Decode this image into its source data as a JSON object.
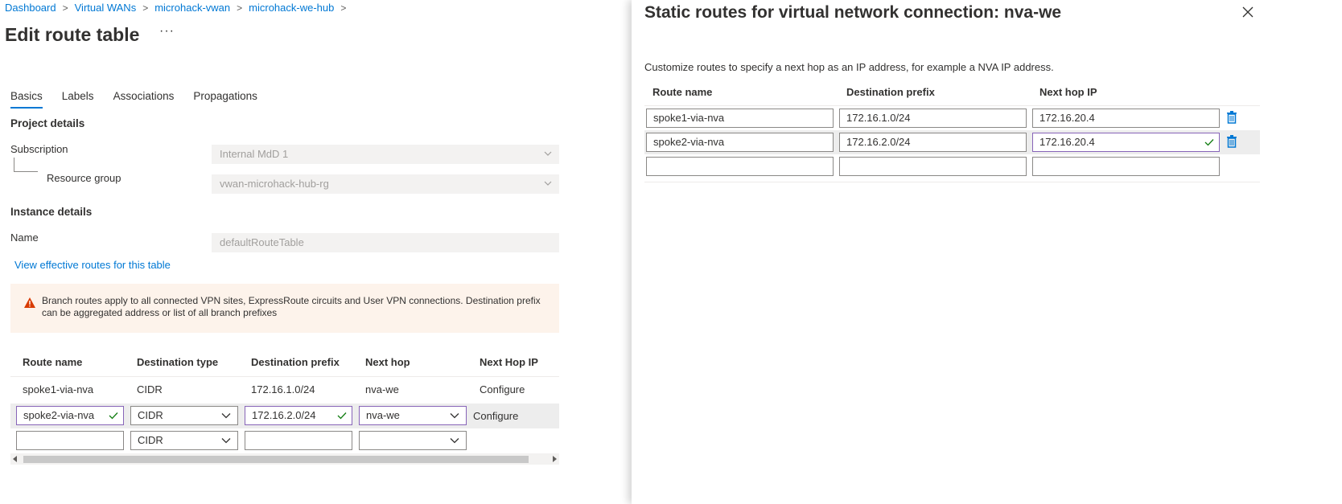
{
  "breadcrumb": {
    "items": [
      "Dashboard",
      "Virtual WANs",
      "microhack-vwan",
      "microhack-we-hub"
    ],
    "separator": ">"
  },
  "page": {
    "title": "Edit route table",
    "more_label": "···"
  },
  "tabs": [
    "Basics",
    "Labels",
    "Associations",
    "Propagations"
  ],
  "project_details": {
    "heading": "Project details",
    "subscription_label": "Subscription",
    "subscription_value": "Internal MdD 1",
    "resource_group_label": "Resource group",
    "resource_group_value": "vwan-microhack-hub-rg"
  },
  "instance_details": {
    "heading": "Instance details",
    "name_label": "Name",
    "name_value": "defaultRouteTable"
  },
  "effective_routes_link": "View effective routes for this table",
  "warning": {
    "text": "Branch routes apply to all connected VPN sites, ExpressRoute circuits and User VPN connections. Destination prefix can be aggregated address or list of all branch prefixes",
    "color": "#d83b01"
  },
  "routes_table": {
    "headers": [
      "Route name",
      "Destination type",
      "Destination prefix",
      "Next hop",
      "Next Hop IP"
    ],
    "row1": {
      "name": "spoke1-via-nva",
      "dest_type": "CIDR",
      "prefix": "172.16.1.0/24",
      "next_hop": "nva-we",
      "next_hop_ip": "Configure"
    },
    "row2": {
      "name": "spoke2-via-nva",
      "dest_type": "CIDR",
      "prefix": "172.16.2.0/24",
      "next_hop": "nva-we",
      "next_hop_ip": "Configure"
    },
    "row3": {
      "name": "",
      "dest_type": "CIDR",
      "prefix": "",
      "next_hop": ""
    }
  },
  "panel": {
    "title": "Static routes for virtual network connection: nva-we",
    "description": "Customize routes to specify a next hop as an IP address, for example a NVA IP address.",
    "headers": [
      "Route name",
      "Destination prefix",
      "Next hop IP"
    ],
    "rows": [
      {
        "name": "spoke1-via-nva",
        "prefix": "172.16.1.0/24",
        "next_hop_ip": "172.16.20.4"
      },
      {
        "name": "spoke2-via-nva",
        "prefix": "172.16.2.0/24",
        "next_hop_ip": "172.16.20.4"
      },
      {
        "name": "",
        "prefix": "",
        "next_hop_ip": ""
      }
    ]
  },
  "colors": {
    "accent": "#0078d4",
    "valid_border": "#8764b8",
    "valid_check": "#107c10",
    "warning_bg": "#fdf3eb"
  }
}
